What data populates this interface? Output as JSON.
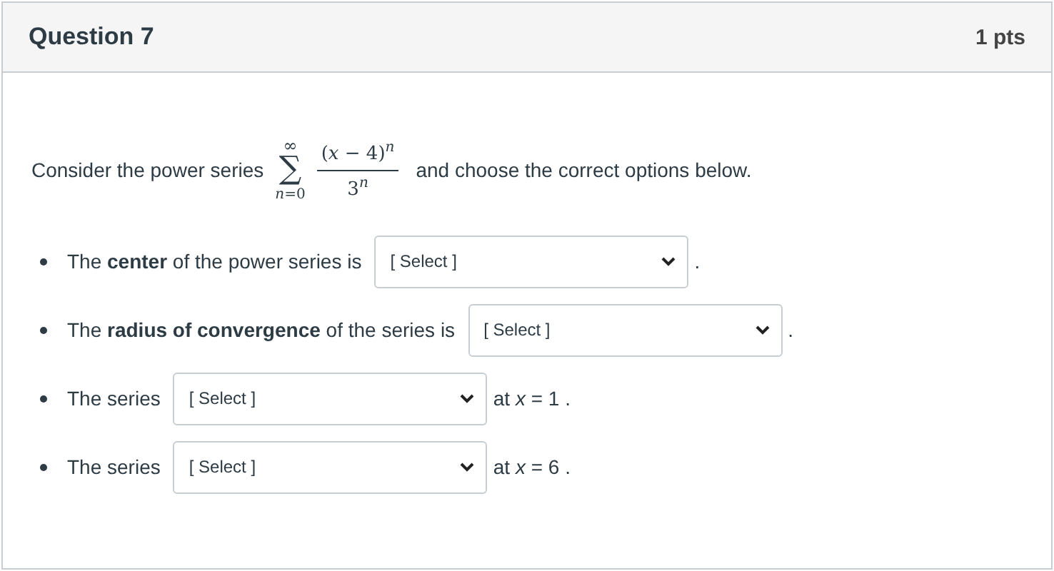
{
  "question": {
    "title": "Question 7",
    "points": "1 pts"
  },
  "intro": {
    "before": "Consider the power series",
    "sum_symbol": "∑",
    "sum_upper": "∞",
    "sum_lower": "*n*=0",
    "numerator": "(*x* − 4)$^{n}$",
    "denominator": "3$^{n}$",
    "after": "and choose the correct options below."
  },
  "items": [
    {
      "before": "The **center** of the power series is",
      "select": "[ Select ]",
      "after": "."
    },
    {
      "before": "The **radius of convergence** of the series is",
      "select": "[ Select ]",
      "after": "."
    },
    {
      "before": "The series",
      "select": "[ Select ]",
      "after": "at  *x* = 1 ."
    },
    {
      "before": "The series",
      "select": "[ Select ]",
      "after": "at  *x* = 6 ."
    }
  ]
}
